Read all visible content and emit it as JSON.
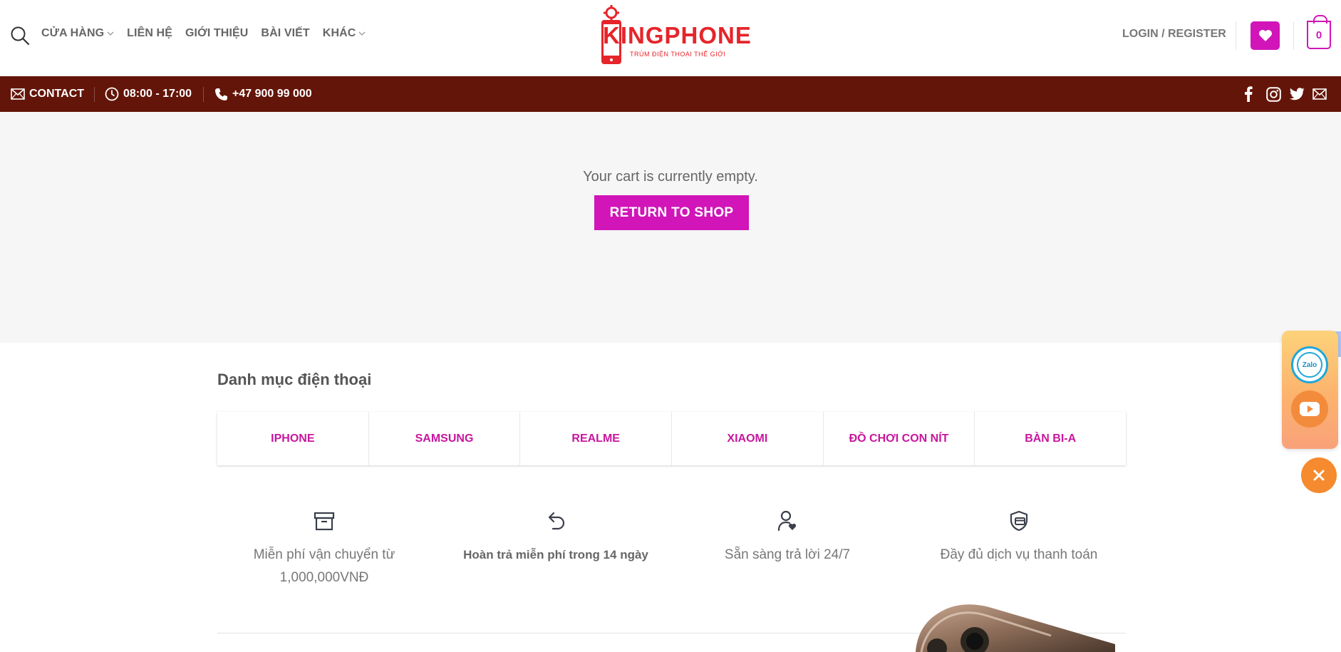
{
  "header": {
    "nav": [
      {
        "label": "CỬA HÀNG",
        "has_dropdown": true
      },
      {
        "label": "LIÊN HỆ",
        "has_dropdown": false
      },
      {
        "label": "GIỚI THIỆU",
        "has_dropdown": false
      },
      {
        "label": "BÀI VIẾT",
        "has_dropdown": false
      },
      {
        "label": "KHÁC",
        "has_dropdown": true
      }
    ],
    "logo": {
      "text": "KINGPHONE",
      "tagline": "TRÙM ĐIỆN THOẠI THẾ GIỚI"
    },
    "login_label": "LOGIN / REGISTER",
    "cart_count": "0"
  },
  "topbar": {
    "contact_label": "CONTACT",
    "hours": "08:00 - 17:00",
    "phone": "+47 900 99 000",
    "social": [
      "facebook-icon",
      "instagram-icon",
      "twitter-icon",
      "email-icon"
    ]
  },
  "cart": {
    "empty_message": "Your cart is currently empty.",
    "return_button": "RETURN TO SHOP"
  },
  "categories": {
    "title": "Danh mục điện thoại",
    "items": [
      "IPHONE",
      "SAMSUNG",
      "REALME",
      "XIAOMI",
      "ĐỒ CHƠI CON NÍT",
      "BÀN BI-A"
    ]
  },
  "features": [
    {
      "icon": "archive-box-icon",
      "lines": [
        "Miễn phí vận chuyển từ",
        "1,000,000VNĐ"
      ],
      "bold": false
    },
    {
      "icon": "return-arrow-icon",
      "lines": [
        "Hoàn trả miễn phí trong 14 ngày"
      ],
      "bold": true
    },
    {
      "icon": "user-heart-icon",
      "lines": [
        "Sẵn sàng trả lời 24/7"
      ],
      "bold": false
    },
    {
      "icon": "shield-card-icon",
      "lines": [
        "Đầy đủ dịch vụ thanh toán"
      ],
      "bold": false
    }
  ],
  "float_widget": {
    "zalo_label": "Zalo"
  },
  "colors": {
    "accent": "#d115b8",
    "topbar_bg": "#641509",
    "category_text": "#c8169d",
    "float_close": "#f58a2e"
  }
}
